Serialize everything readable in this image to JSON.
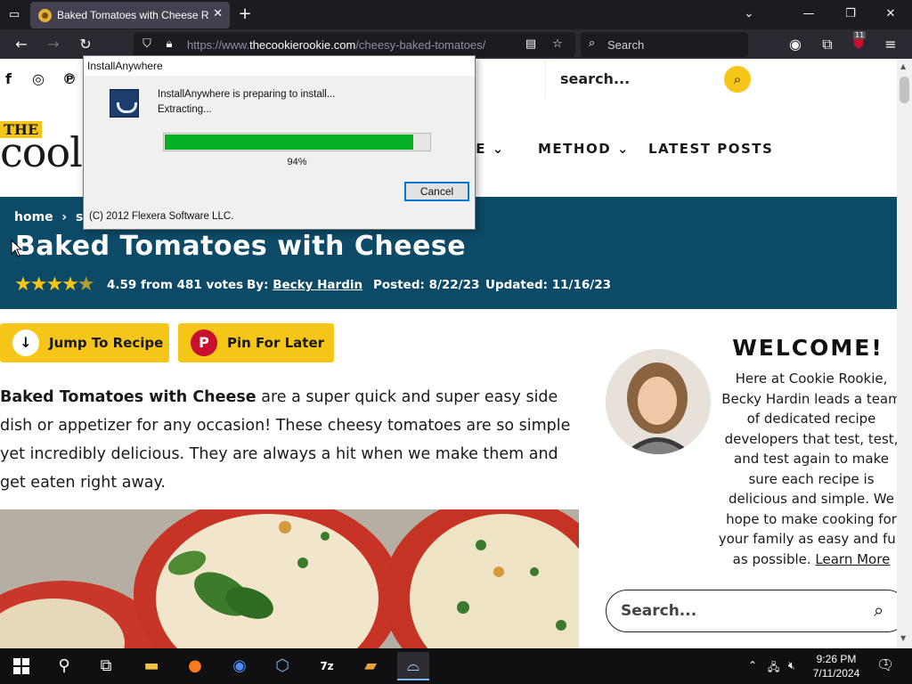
{
  "browser": {
    "tab_title": "Baked Tomatoes with Cheese Re",
    "url_prefix": "https://www.",
    "url_domain": "thecookierookie.com",
    "url_path": "/cheesy-baked-tomatoes/",
    "search_placeholder": "Search",
    "extension_badge": "11"
  },
  "site": {
    "top_search_label": "search...",
    "logo_the": "THE",
    "logo_text": "cool",
    "menu": [
      "SE",
      "METHOD",
      "LATEST POSTS"
    ],
    "breadcrumb_home": "home",
    "breadcrumb_next": "sic",
    "title": "Baked Tomatoes with Cheese",
    "rating": 4.59,
    "rating_text": "4.59 from 481 votes",
    "by_label": "By:",
    "author": "Becky Hardin",
    "posted": "Posted: 8/22/23",
    "updated": "Updated: 11/16/23",
    "jump_button": "Jump To Recipe",
    "pin_button": "Pin For Later",
    "intro_bold": "Baked Tomatoes with Cheese",
    "intro_rest": " are a super quick and super easy side dish or appetizer for any occasion! These cheesy tomatoes are so simple yet incredibly delicious. They are always a hit when we make them and get eaten right away.",
    "welcome_heading": "WELCOME!",
    "welcome_text": "Here at Cookie Rookie, Becky Hardin leads a team of dedicated recipe developers that test, test, and test again to make sure each recipe is delicious and simple. We hope to make cooking for your family as easy and fun as possible.",
    "learn_more": "Learn More",
    "sidebar_search_placeholder": "Search..."
  },
  "dialog": {
    "title": "InstallAnywhere",
    "message_line1": "InstallAnywhere is preparing to install...",
    "message_line2": "Extracting...",
    "progress": 0.94,
    "progress_label": "94%",
    "cancel_label": "Cancel",
    "copyright": "(C) 2012 Flexera Software LLC."
  },
  "taskbar": {
    "time": "9:26 PM",
    "date": "7/11/2024",
    "notification_count": "1",
    "icons": [
      "start-icon",
      "search-icon",
      "task-view-icon",
      "file-explorer-icon",
      "firefox-icon",
      "chrome-icon",
      "virtualbox-icon",
      "7zip-icon",
      "app-icon",
      "installanywhere-icon"
    ]
  },
  "colors": {
    "hero_bg": "#0d4a67",
    "accent_yellow": "#f5c518",
    "progress_green": "#06b025"
  }
}
